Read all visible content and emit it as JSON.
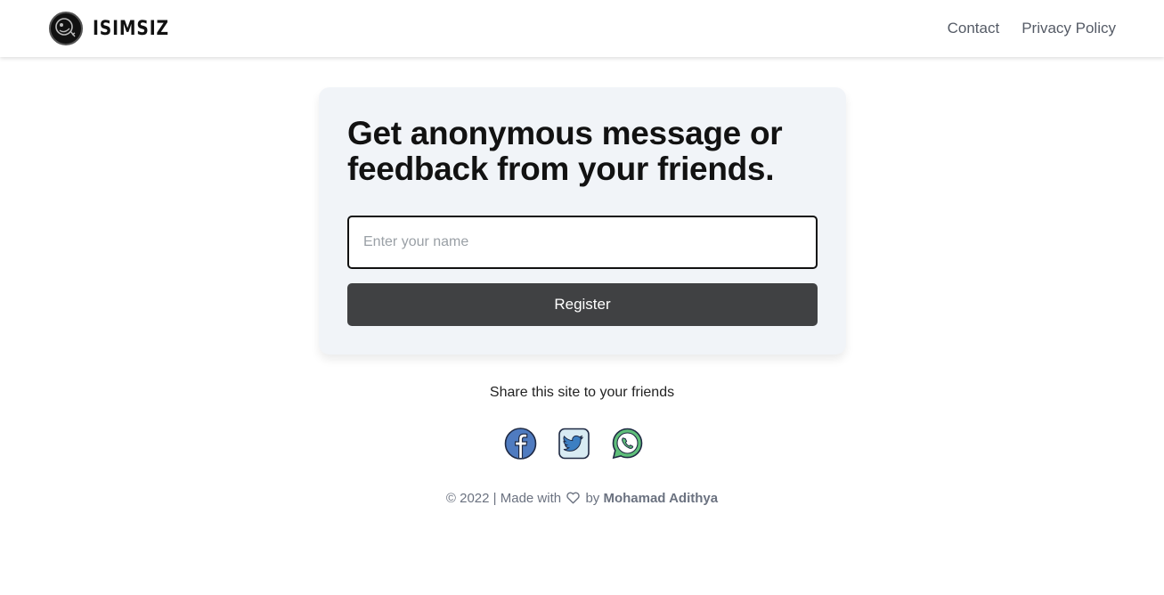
{
  "navbar": {
    "brand": "ISIMSIZ",
    "links": [
      {
        "label": "Contact"
      },
      {
        "label": "Privacy Policy"
      }
    ]
  },
  "card": {
    "headline": "Get anonymous message or feedback from your friends.",
    "name_input": {
      "value": "",
      "placeholder": "Enter your name"
    },
    "register_label": "Register"
  },
  "share": {
    "text": "Share this site to your friends",
    "icons": [
      "facebook-icon",
      "twitter-icon",
      "whatsapp-icon"
    ]
  },
  "footer": {
    "copyright": "© 2022 | Made with",
    "by": "by",
    "author": "Mohamad Adithya"
  },
  "colors": {
    "card_bg": "#f1f4f8",
    "button_bg": "#404143",
    "nav_link": "#555b66",
    "footer_text": "#6b7280"
  }
}
